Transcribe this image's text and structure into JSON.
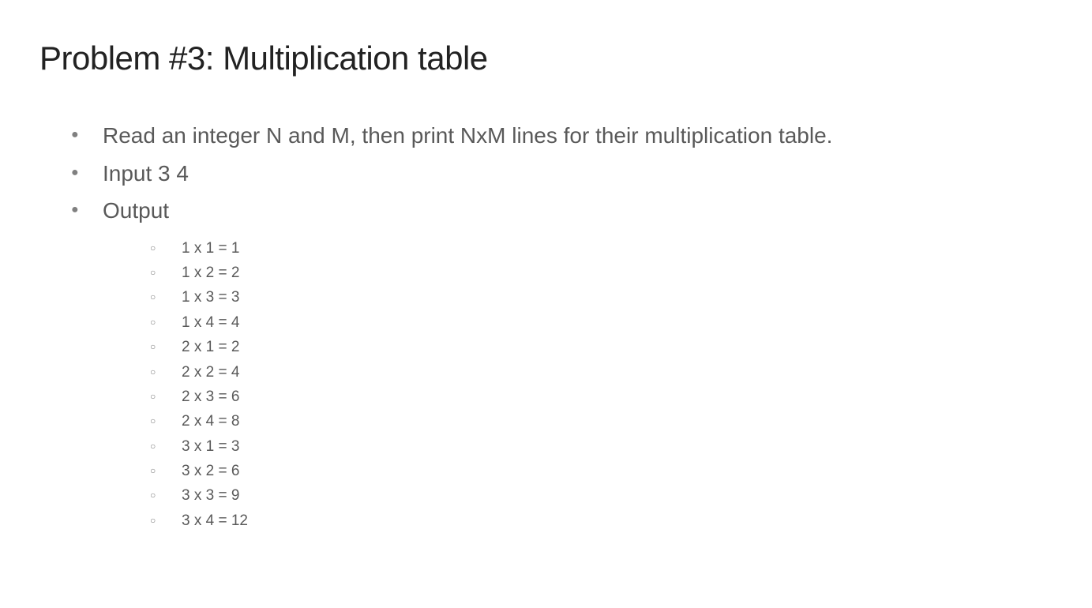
{
  "title": "Problem #3: Multiplication table",
  "bullets": {
    "description": "Read an integer N and M, then print NxM lines for their multiplication table.",
    "input": "Input 3 4",
    "output_label": "Output"
  },
  "output_lines": [
    "1 x 1 = 1",
    "1 x 2 = 2",
    "1 x 3 = 3",
    "1 x 4 = 4",
    "2 x 1 = 2",
    "2 x 2 = 4",
    "2 x 3 = 6",
    "2 x 4 = 8",
    "3 x 1 = 3",
    "3 x 2 = 6",
    "3 x 3 = 9",
    "3 x 4 = 12"
  ]
}
